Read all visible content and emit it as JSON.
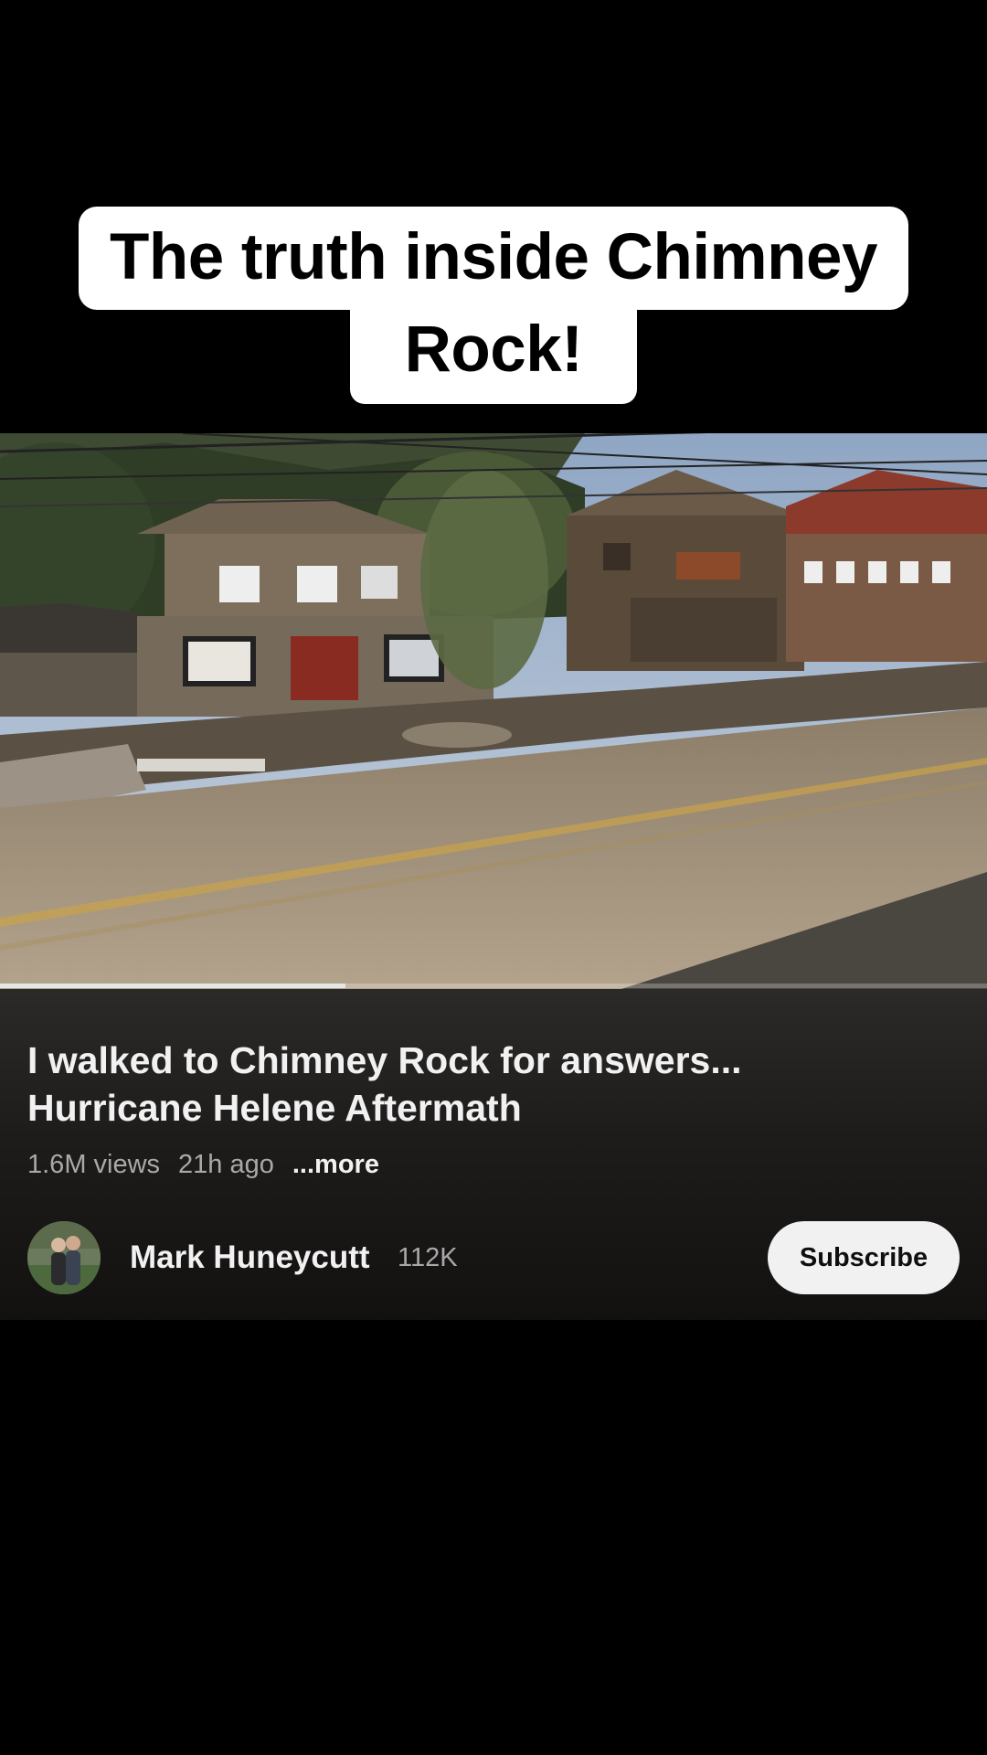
{
  "caption": {
    "line1": "The truth inside Chimney",
    "line2": "Rock!"
  },
  "video": {
    "progress": 0.35,
    "title_line1": "I walked to Chimney Rock for answers...",
    "title_line2": "Hurricane Helene Aftermath",
    "views": "1.6M views",
    "age": "21h ago",
    "more": "...more"
  },
  "channel": {
    "name": "Mark Huneycutt",
    "subscribers": "112K",
    "subscribe_label": "Subscribe"
  }
}
